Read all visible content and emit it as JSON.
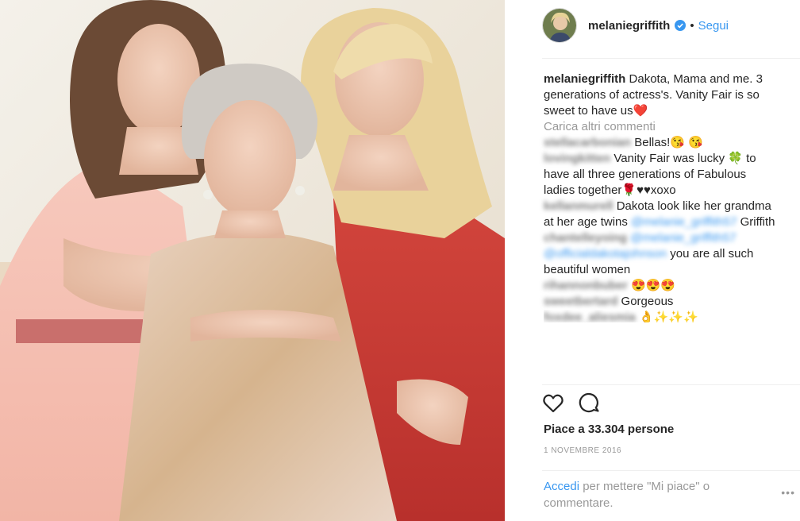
{
  "post": {
    "username": "melaniegriffith",
    "follow_label": "Segui",
    "dot": "•",
    "caption": "Dakota, Mama and me. 3 generations of actress's. Vanity Fair is so sweet to have us❤️",
    "load_more": "Carica altri commenti",
    "comments": [
      {
        "user": "stellacarbonian",
        "user_link": "",
        "text": "Bellas!😘 😘",
        "text2": ""
      },
      {
        "user": "lovingkitten",
        "user_link": "",
        "text": "Vanity Fair was lucky 🍀 to have all three generations of Fabulous ladies together🌹♥♥xoxo",
        "text2": ""
      },
      {
        "user": "kellanmurell",
        "user_link": "@melanie_griffith57",
        "text": "Dakota look like her grandma at her age twins",
        "text2": "Griffith"
      },
      {
        "user": "chantelleyoing",
        "user_link": "@melanie_griffith57 @officialdakotajohnson",
        "text": "you are all such beautiful women",
        "text2": ""
      },
      {
        "user": "rihannonbuber",
        "user_link": "",
        "text": "😍😍😍",
        "text2": ""
      },
      {
        "user": "sweetbertard",
        "user_link": "",
        "text": "Gorgeous",
        "text2": ""
      },
      {
        "user": "foxdee_aliesmia",
        "user_link": "",
        "text": "👌✨✨✨",
        "text2": ""
      }
    ],
    "likes": "Piace a 33.304 persone",
    "date": "1 NOVEMBRE 2016",
    "login_link": "Accedi",
    "login_text": "per mettere \"Mi piace\" o commentare.",
    "more_dots": "•••"
  },
  "icons": {
    "heart": "heart-icon",
    "comment": "comment-icon",
    "verified": "verified-badge-icon",
    "more": "more-options-icon"
  },
  "colors": {
    "link": "#3897f0",
    "muted": "#999999",
    "text": "#262626"
  }
}
